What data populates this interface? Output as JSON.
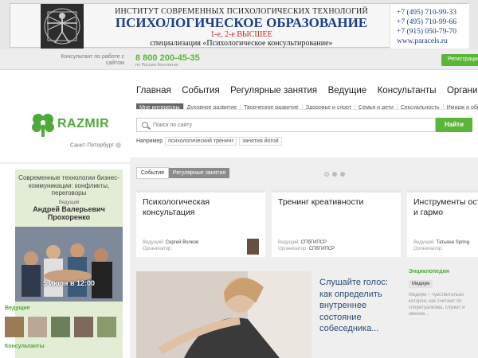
{
  "banner": {
    "line1": "ИНСТИТУТ СОВРЕМЕННЫХ ПСИХОЛОГИЧЕСКИХ ТЕХНОЛОГИЙ",
    "line2": "ПСИХОЛОГИЧЕСКОЕ ОБРАЗОВАНИЕ",
    "line3": "1-е, 2-е ВЫСШЕЕ",
    "line4": "специализация «Психологическое консультирование»",
    "phones": [
      "+7 (495) 710-99-33",
      "+7 (495) 710-99-66",
      "+7 (915) 050-79-70",
      "www.paracels.ru"
    ]
  },
  "header": {
    "consultant_note": "Консультант по работе с сайтом",
    "phone": "8 800 200-45-35",
    "phone_sub": "по России бесплатно",
    "register": "Регистрация"
  },
  "logo": {
    "text": "RAZMIR",
    "city": "Санкт-Петербург",
    "color": "#4fa83c"
  },
  "nav": {
    "items": [
      "Главная",
      "События",
      "Регулярные занятия",
      "Ведущие",
      "Консультанты",
      "Организации"
    ]
  },
  "subnav": {
    "items": [
      "Мне интересны",
      "Духовное развитие",
      "Творческое развитие",
      "Здоровье и спорт",
      "Семья и дети",
      "Сексуальность",
      "Имидж и обр"
    ]
  },
  "search": {
    "placeholder": "Поиск по сайту",
    "button": "Найти",
    "example_label": "Например",
    "examples": [
      "психологический тренинг",
      "занятия йогой"
    ]
  },
  "promo": {
    "title": "Современные технологии бизнес-коммуникации: конфликты, переговоры",
    "leader_label": "Ведущий",
    "leader_name": "Андрей Валерьевич Прохоренко",
    "date": "5 июля в 12:00"
  },
  "sidebar": {
    "leaders_label": "Ведущие",
    "consultants_label": "Консультанты"
  },
  "tabs": [
    "События",
    "Регулярные занятия"
  ],
  "cards": [
    {
      "title": "Психологическая консультация",
      "lead_label": "Ведущий:",
      "lead": "Сергей Волков",
      "org_label": "Организатор:",
      "org": ""
    },
    {
      "title": "Тренинг креативности",
      "lead_label": "Ведущий:",
      "lead": "СПбГИПСР",
      "org_label": "Организатор:",
      "org": "СПбГИПСР"
    },
    {
      "title": "Инструменты оста в балансе и гармо",
      "lead_label": "Ведущий:",
      "lead": "Татьяна Spring",
      "org_label": "Организатор:",
      "org": ""
    }
  ],
  "article": {
    "title": "Слушайте голос: как определить внутреннее состояние собеседника..."
  },
  "encyclopedia": {
    "label": "Энциклопедия",
    "tag": "Медиум",
    "text": "Медиум – чувствительно которое, как считают по спиритуализма, служит и звеном..."
  },
  "colors": {
    "accent": "#5cb53b",
    "banner_title": "#1c3d8c",
    "banner_red": "#c8261d",
    "article_title": "#2c4c75"
  }
}
